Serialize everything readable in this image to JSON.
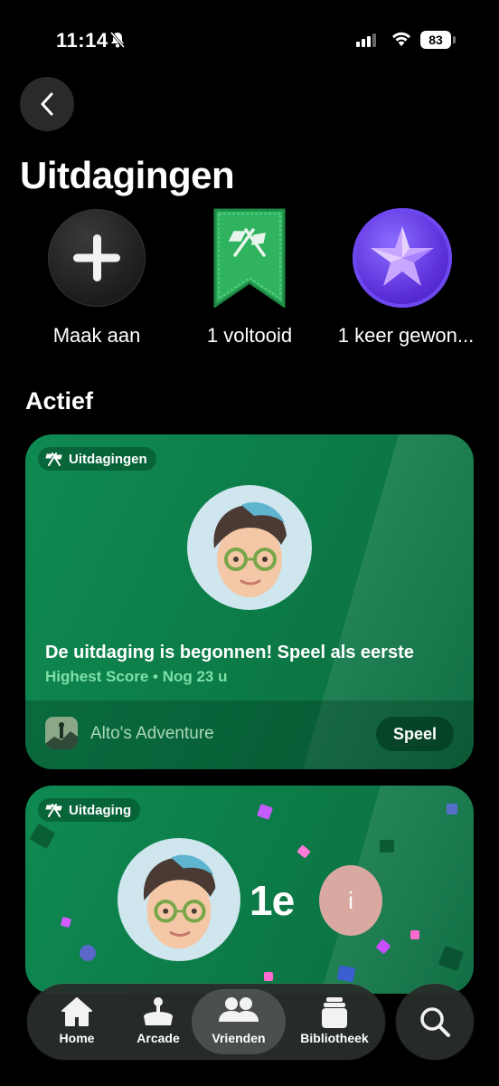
{
  "status": {
    "time": "11:14",
    "battery": "83"
  },
  "header": {
    "title": "Uitdagingen"
  },
  "summary": [
    {
      "label": "Maak aan",
      "icon": "plus-icon"
    },
    {
      "label": "1 voltooid",
      "icon": "flags-banner-icon"
    },
    {
      "label": "1 keer gewon...",
      "icon": "star-medal-icon"
    }
  ],
  "section": {
    "title": "Actief"
  },
  "cards": [
    {
      "tag": "Uitdagingen",
      "headline": "De uitdaging is begonnen! Speel als eerste",
      "subtitle": "Highest Score • Nog 23 u",
      "game": "Alto's Adventure",
      "button": "Speel"
    },
    {
      "tag": "Uitdaging",
      "rank": "1e",
      "opponent_initial": "i"
    }
  ],
  "tabbar": {
    "tabs": [
      {
        "label": "Home",
        "icon": "home-icon"
      },
      {
        "label": "Arcade",
        "icon": "joystick-icon"
      },
      {
        "label": "Vrienden",
        "icon": "friends-icon",
        "active": true
      },
      {
        "label": "Bibliotheek",
        "icon": "library-icon"
      }
    ],
    "search_icon": "search-icon"
  },
  "colors": {
    "card_green": "#0f8a52",
    "accent_green_text": "#7ee0a8",
    "medal_purple": "#5b2fd9"
  }
}
